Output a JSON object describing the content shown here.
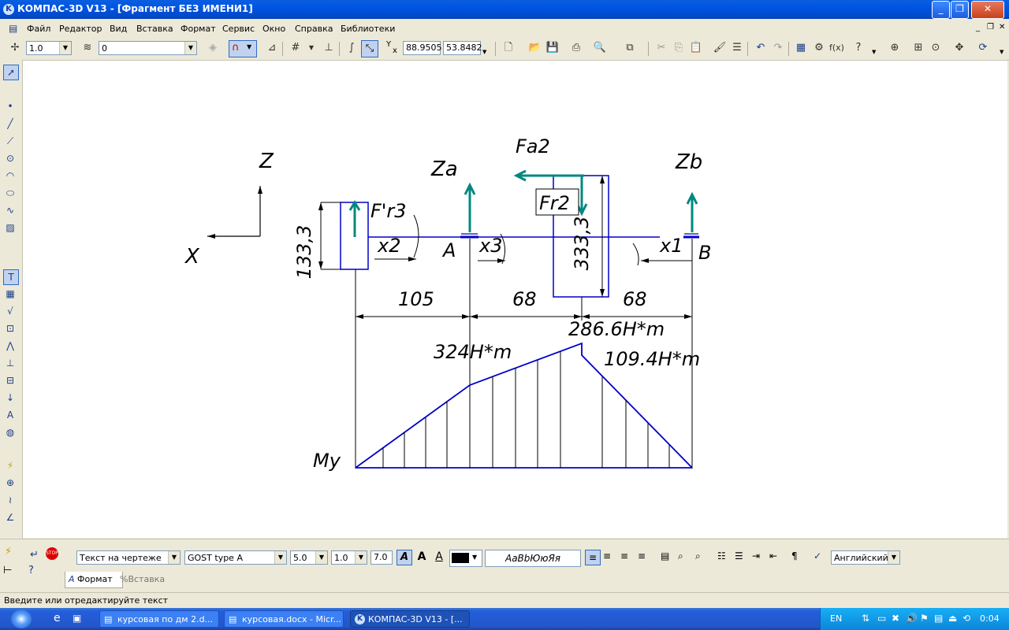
{
  "window": {
    "title": "КОМПАС-3D V13 - [Фрагмент БЕЗ ИМЕНИ1]",
    "app_icon": "kompas-icon"
  },
  "menu": [
    "Файл",
    "Редактор",
    "Вид",
    "Вставка",
    "Формат",
    "Сервис",
    "Окно",
    "Справка",
    "Библиотеки"
  ],
  "toolbar": {
    "scale_value": "1.0",
    "layer_value": "0",
    "coord_x": "88.9505",
    "coord_y": "53.8482",
    "coord_prefix_y": "Y",
    "coord_prefix_x": "x"
  },
  "drawing": {
    "labels": {
      "Z": "Z",
      "X": "X",
      "Za": "Za",
      "Zb": "Zb",
      "Fa2": "Fa2",
      "Fr2": "Fr2",
      "Fr3": "F'r3",
      "x1": "x1",
      "x2": "x2",
      "x3": "x3",
      "A": "A",
      "B": "B",
      "dim_133": "133,3",
      "dim_333": "333,3",
      "dim_105": "105",
      "dim_68a": "68",
      "dim_68b": "68",
      "m_324": "324H*m",
      "m_2866": "286.6H*m",
      "m_1094": "109.4H*m",
      "My": "My"
    }
  },
  "properties": {
    "text_style": "Текст на чертеже",
    "font": "GOST type A",
    "size": "5.0",
    "narrowing": "1.0",
    "step": "7.0",
    "sample": "АаВbЮюЯя",
    "language": "Английский",
    "tab_format": "Формат",
    "tab_insert": "Вставка"
  },
  "status": {
    "message": "Введите или отредактируйте текст"
  },
  "taskbar": {
    "items": [
      "курсовая по дм 2.d...",
      "курсовая.docx - Micr...",
      "КОМПАС-3D V13 - [..."
    ],
    "lang": "EN",
    "clock": "0:04"
  },
  "colors": {
    "drawing_lines": "#0000c8",
    "arrows_teal": "#00887f",
    "titlebar": "#0054e3"
  }
}
